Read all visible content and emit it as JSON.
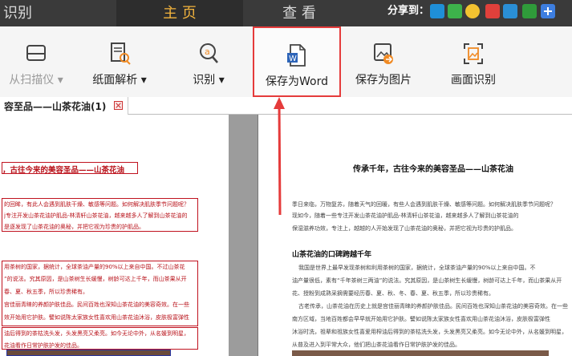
{
  "topbar": {
    "left_tab": "识别",
    "main_tab": "主 页",
    "view_tab": "查 看",
    "share_label": "分享到："
  },
  "share_icons": [
    "qq-icon",
    "wechat-icon",
    "qzone-icon",
    "weibo-icon",
    "tencent-weibo-icon",
    "douban-icon",
    "plus-icon"
  ],
  "colors": {
    "accent": "#f3b43d",
    "highlight_border": "#e53b3b",
    "topbar": "#3a3a3a"
  },
  "toolbar": {
    "scan": "从扫描仪 ▾",
    "page_analysis": "纸面解析 ▾",
    "recognize": "识别 ▾",
    "save_word": "保存为Word",
    "save_image": "保存为图片",
    "screen_recognize": "画面识别"
  },
  "doc_tab": {
    "label": "容至品——山茶花油(1)"
  },
  "left_doc": {
    "title": "，古往今来的美容圣品——山茶花油",
    "para1": [
      "的回眸，有此人会遇到肌肤干燥、敏感等问题。如何解决肌肤季节问题呢？",
      "j专注开发山茶花油护肌品-林清轩山茶花油，越来越多人了解到山茶花油的",
      "是逐发现了山茶花油的奥秘，并把它视为珍贵的护肌品。"
    ],
    "para2": [
      "用茶树的国家，据统计，全球茶油产量的90%以上来自中国。不过山茶花",
      "”的说法。究其原因，是山茶树生长缓慢，树龄可达上千年，而山茶果从开",
      "春、夏、秋五季，所以珍贵稀有。",
      "宫佳丽青睐的养颜护肤佳品。民间百姓也深知山茶花油的美容奇效。在一些",
      "效开始用它护肤。譬如说陈太家族女性喜欢用山茶花油沐浴，皮肤极富弹性"
    ],
    "para3": [
      "油后得到的茶枯洗头发，头发黑亮又柔亮。如今无论中外，从名媛到明星，",
      "花油看作日常护肤护发的佳品。"
    ]
  },
  "right_doc": {
    "title": "传承千年，古往今来的美容圣品——山茶花油",
    "para1": [
      "季日来临，万物复苏，随着天气的回暖，有些人会遇到肌肤干燥、敏感等问题。如何解决肌肤季节问题呢？",
      "现如今，随着一些专注开发山茶花油护肌品-林清轩山茶花油，越来越多人了解到山茶花油的",
      "保湿滋养功效，专注上，越越的人开始发现了山茶花油的奥秘，并把它视为珍贵的护肌品。"
    ],
    "section_title": "山茶花油的口碑跨越千年",
    "para2": [
      "我国是世界上最早发现茶树和利用茶树的国家，据统计，全球茶油产量的90%以上来自中国。不",
      "油产量很低，素有“千年茶树三两油”的说法。究其原因，是山茶树生长缓慢，树龄可达上千年，而山茶果从开",
      "花、授粉到成熟采摘需要经历春、夏、秋、冬、春、夏、秋五季，所以珍贵稀有。",
      "古老传承，山茶花油在历史上就是宫佳丽青睐的养颜护肤佳品。民间百姓也深知山茶花油的美容奇效。在一些",
      "南方区域，当地百姓都会早早就开始用它护肤。譬如说陈太家族女性喜欢用山茶花油沐浴，皮肤极富弹性",
      "沐浴时洗，祖辈和祖族女性喜爱用榨油后得到的茶枯洗头发，头发黑亮又柔亮。如今无论中外，从名媛到明星，",
      "从普及进入到平常大众，他们把山茶花油看作日常护肤护发的佳品。"
    ]
  }
}
